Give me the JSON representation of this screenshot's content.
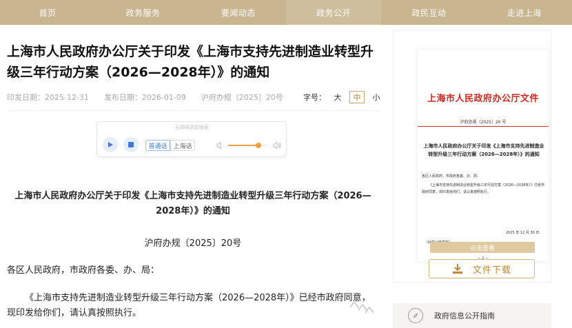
{
  "nav": {
    "items": [
      {
        "label": "首页"
      },
      {
        "label": "政务服务"
      },
      {
        "label": "要闻动态"
      },
      {
        "label": "政务公开"
      },
      {
        "label": "政民互动"
      },
      {
        "label": "走进上海"
      }
    ],
    "active_index": 3
  },
  "article": {
    "title": "上海市人民政府办公厅关于印发《上海市支持先进制造业转型升级三年行动方案（2026—2028年）》的通知",
    "issue_date": "印发日期：2025-12-31",
    "publish_date": "发布日期：2026-01-09",
    "doc_number": "沪府办规〔2025〕20号",
    "font_size_label": "字号：",
    "font_sizes": [
      "大",
      "中",
      "小"
    ],
    "font_size_active": "中"
  },
  "player": {
    "caption": "无障碍语音播报",
    "play_icon": "play-icon",
    "stop_icon": "stop-icon",
    "lang_mandarin": "普通话",
    "lang_shanghai": "上海话",
    "volume_level": 0.75
  },
  "body": {
    "heading": "上海市人民政府办公厅关于印发《上海市支持先进制造业转型升级三年行动方案（2026—2028年）》的通知",
    "doc_number": "沪府办规〔2025〕20号",
    "salutation": "各区人民政府，市政府各委、办、局：",
    "paragraph": "《上海市支持先进制造业转型升级三年行动方案（2026—2028年）》已经市政府同意，现印发给你们，请认真按照执行。"
  },
  "sidebar": {
    "doc_header": "上海市人民政府办公厅文件",
    "doc_num": "沪府办规〔2025〕20 号",
    "doc_title": "上海市人民政府办公厅关于印发《上海市支持先进制造业转型升级三年行动方案（2026—2028年）》的通知",
    "doc_salute": "各区人民政府，市政府各委、办、局：",
    "doc_para": "《上海市支持先进制造业转型升级三年行动方案（2026—2028年）》已经市政府同意，现印发给你们，请认真按照执行。",
    "doc_date": "2025 年 12 月 30 日",
    "doc_footer": "（此件公开发布）",
    "doc_page": "— 1 —",
    "view_label": "点击查看",
    "download_label": "文件下载",
    "guide_label": "政府信息公开指南"
  },
  "colors": {
    "nav_bg": "#c9b58f",
    "accent_gold": "#c08a3c",
    "doc_red": "#d0281e",
    "player_blue": "#3a7be0"
  }
}
